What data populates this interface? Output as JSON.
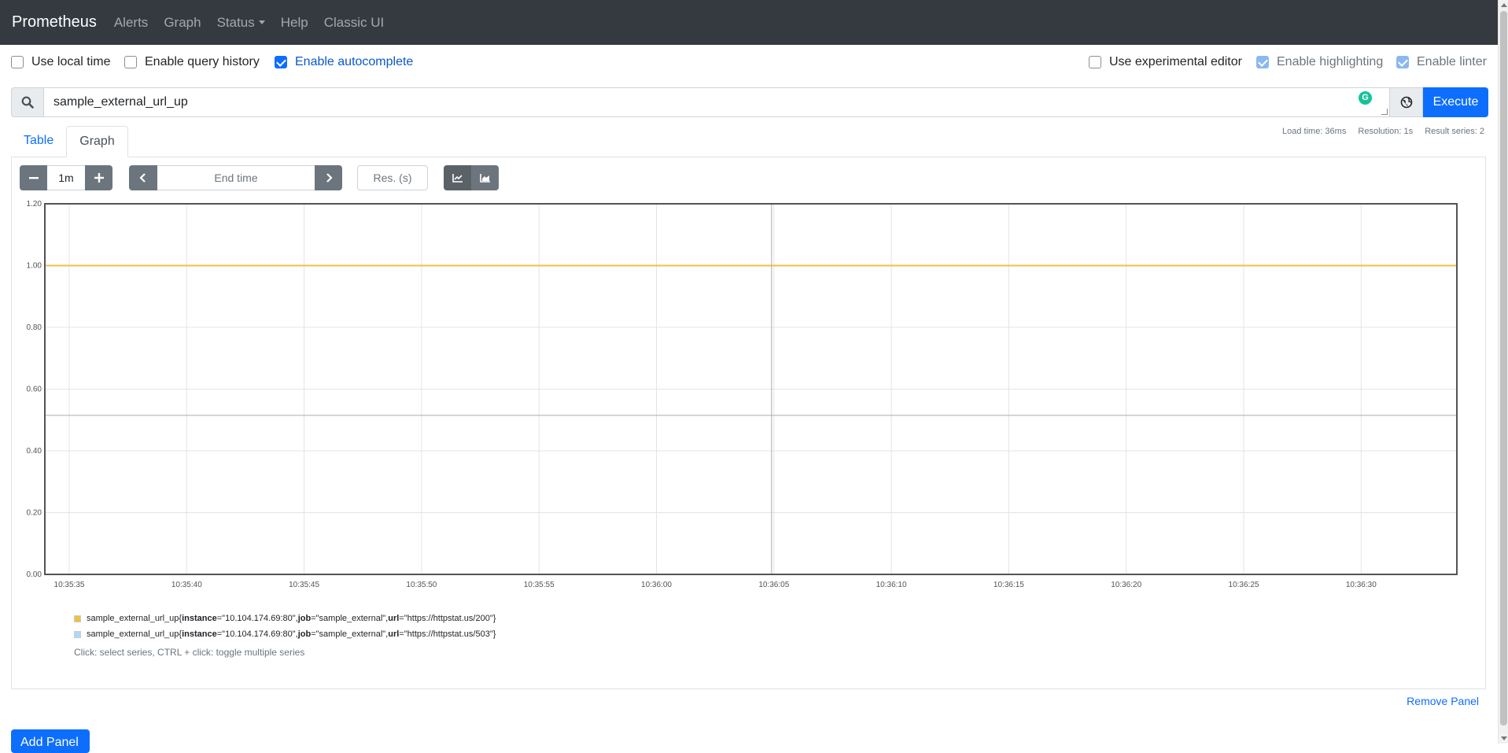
{
  "nav": {
    "brand": "Prometheus",
    "items": [
      "Alerts",
      "Graph",
      "Status",
      "Help",
      "Classic UI"
    ]
  },
  "options": {
    "local_time": {
      "label": "Use local time",
      "checked": false
    },
    "query_history": {
      "label": "Enable query history",
      "checked": false
    },
    "autocomplete": {
      "label": "Enable autocomplete",
      "checked": true
    },
    "experimental_editor": {
      "label": "Use experimental editor",
      "checked": false
    },
    "highlighting": {
      "label": "Enable highlighting",
      "checked": true
    },
    "linter": {
      "label": "Enable linter",
      "checked": true
    }
  },
  "query": {
    "expression": "sample_external_url_up",
    "execute_label": "Execute",
    "icons": {
      "search": "search-icon",
      "metrics": "globe-icon",
      "grammarly": "grammarly-icon"
    }
  },
  "stats": {
    "load_time": "Load time: 36ms",
    "resolution": "Resolution: 1s",
    "result_series": "Result series: 2"
  },
  "tabs": {
    "table": "Table",
    "graph": "Graph",
    "active": "graph"
  },
  "controls": {
    "range": "1m",
    "end_time_placeholder": "End time",
    "resolution_placeholder": "Res. (s)",
    "minus": "−",
    "plus": "+"
  },
  "chart_data": {
    "type": "line",
    "x": [
      "10:35:35",
      "10:35:40",
      "10:35:45",
      "10:35:50",
      "10:35:55",
      "10:36:00",
      "10:36:05",
      "10:36:10",
      "10:36:15",
      "10:36:20",
      "10:36:25",
      "10:36:30"
    ],
    "ylim": [
      0,
      1.2
    ],
    "yticks": [
      "0.00",
      "0.20",
      "0.40",
      "0.60",
      "0.80",
      "1.00",
      "1.20"
    ],
    "grid": true,
    "series": [
      {
        "name": "sample_external_url_up",
        "color": "#edc240",
        "value": 1.0,
        "labels": [
          [
            "instance",
            "10.104.174.69:80"
          ],
          [
            "job",
            "sample_external"
          ],
          [
            "url",
            "https://httpstat.us/200"
          ]
        ]
      },
      {
        "name": "sample_external_url_up",
        "color": "#afd8f8",
        "value": 0.0,
        "labels": [
          [
            "instance",
            "10.104.174.69:80"
          ],
          [
            "job",
            "sample_external"
          ],
          [
            "url",
            "https://httpstat.us/503"
          ]
        ]
      }
    ],
    "crosshair_y": 0.515
  },
  "legend_hint": "Click: select series, CTRL + click: toggle multiple series",
  "remove_panel": "Remove Panel",
  "add_panel": "Add Panel"
}
